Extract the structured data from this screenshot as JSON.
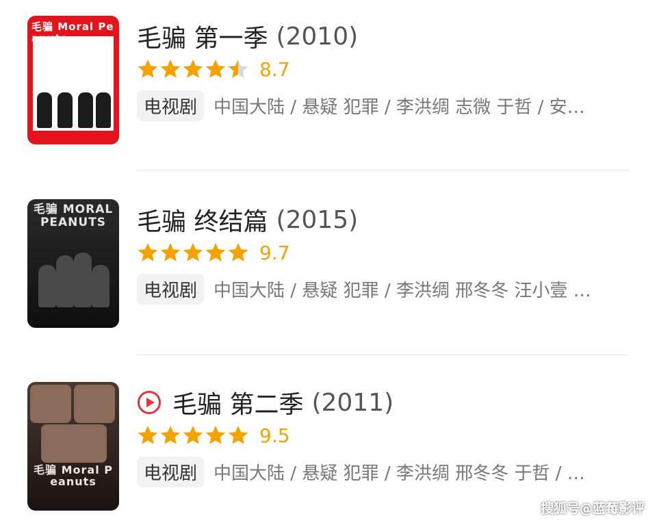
{
  "colors": {
    "star": "#f4a200",
    "star_empty": "#d8d8d8",
    "score": "#f4a200",
    "play_accent": "#e6323c"
  },
  "items": [
    {
      "poster_label": "毛骗 Moral Peanuts",
      "title": "毛骗 第一季",
      "year": "(2010)",
      "rating_stars": 4.5,
      "score": "8.7",
      "type": "电视剧",
      "meta": "中国大陆 / 悬疑 犯罪 / 李洪绸 志微 于哲 / 安…",
      "has_play_icon": false
    },
    {
      "poster_label": "毛骗 MORAL PEANUTS",
      "title": "毛骗 终结篇",
      "year": "(2015)",
      "rating_stars": 5,
      "score": "9.7",
      "type": "电视剧",
      "meta": "中国大陆 / 悬疑 犯罪 / 李洪绸 邢冬冬 汪小壹 …",
      "has_play_icon": false
    },
    {
      "poster_label": "毛骗 Moral Peanuts",
      "title": "毛骗 第二季",
      "year": "(2011)",
      "rating_stars": 5,
      "score": "9.5",
      "type": "电视剧",
      "meta": "中国大陆 / 悬疑 犯罪 / 李洪绸 邢冬冬 于哲 / …",
      "has_play_icon": true,
      "play_icon": "play-circle-icon"
    }
  ],
  "watermark": "搜狐号@蓝莓影评"
}
